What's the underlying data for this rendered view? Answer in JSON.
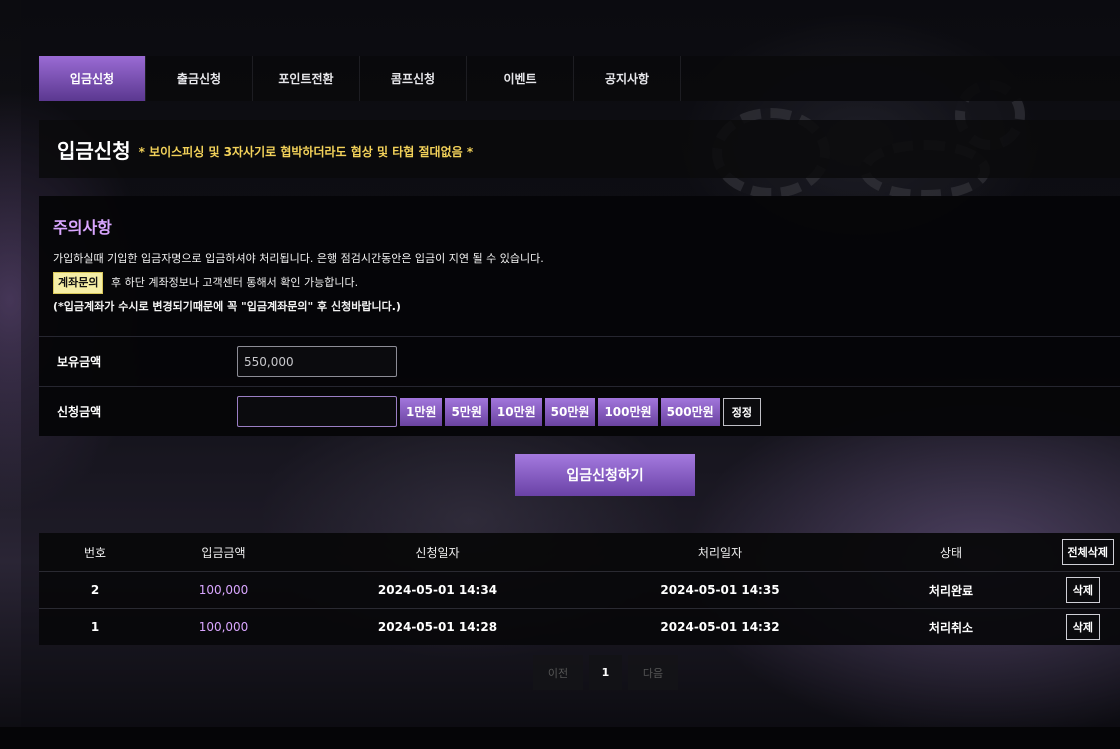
{
  "nav": {
    "tabs": [
      {
        "label": "입금신청",
        "active": true
      },
      {
        "label": "출금신청"
      },
      {
        "label": "포인트전환"
      },
      {
        "label": "콤프신청"
      },
      {
        "label": "이벤트"
      },
      {
        "label": "공지사항"
      }
    ]
  },
  "header": {
    "title": "입금신청",
    "warning": "* 보이스피싱 및 3자사기로 협박하더라도 협상 및 타협 절대없음 *"
  },
  "notice": {
    "heading": "주의사항",
    "line1": "가입하실때 기입한 입금자명으로 입금하셔야 처리됩니다. 은행 점검시간동안은 입금이 지연 될 수 있습니다.",
    "account_button": "계좌문의",
    "line2": "후 하단 계좌정보나 고객센터 통해서 확인 가능합니다.",
    "line3": "(*입금계좌가 수시로 변경되기때문에 꼭 \"입금계좌문의\" 후 신청바랍니다.)"
  },
  "form": {
    "balance_label": "보유금액",
    "balance_value": "550,000",
    "amount_label": "신청금액",
    "amount_value": "",
    "quick_amounts": [
      "1만원",
      "5만원",
      "10만원",
      "50만원",
      "100만원",
      "500만원"
    ],
    "reset_label": "정정",
    "submit_label": "입금신청하기"
  },
  "history": {
    "columns": [
      "번호",
      "입금금액",
      "신청일자",
      "처리일자",
      "상태"
    ],
    "delete_all_label": "전체삭제",
    "delete_label": "삭제",
    "rows": [
      {
        "no": "2",
        "amount": "100,000",
        "requested": "2024-05-01 14:34",
        "processed": "2024-05-01 14:35",
        "status": "처리완료"
      },
      {
        "no": "1",
        "amount": "100,000",
        "requested": "2024-05-01 14:28",
        "processed": "2024-05-01 14:32",
        "status": "처리취소"
      }
    ]
  },
  "pagination": {
    "prev": "이전",
    "current": "1",
    "next": "다음"
  },
  "colors": {
    "accent": "#8a5cc6",
    "warning": "#f3d25a",
    "heading": "#d9a6ff"
  }
}
